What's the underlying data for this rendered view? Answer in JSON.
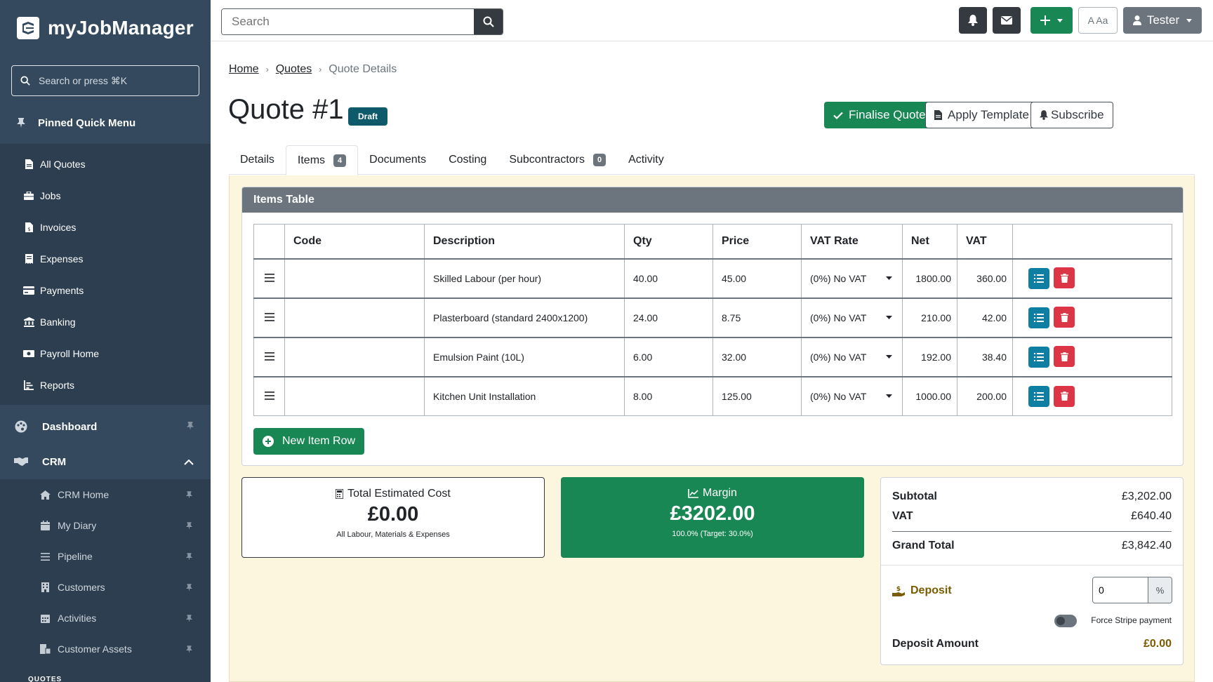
{
  "brand": {
    "name": "myJobManager"
  },
  "sidebar": {
    "search_placeholder": "Search or press ⌘K",
    "pinned_title": "Pinned Quick Menu",
    "pinned_items": [
      {
        "label": "All Quotes",
        "icon": "file-icon"
      },
      {
        "label": "Jobs",
        "icon": "briefcase-icon"
      },
      {
        "label": "Invoices",
        "icon": "file-invoice-icon"
      },
      {
        "label": "Expenses",
        "icon": "receipt-icon"
      },
      {
        "label": "Payments",
        "icon": "credit-card-icon"
      },
      {
        "label": "Banking",
        "icon": "bank-icon"
      },
      {
        "label": "Payroll Home",
        "icon": "money-icon"
      },
      {
        "label": "Reports",
        "icon": "chart-icon"
      }
    ],
    "sections": [
      {
        "label": "Dashboard",
        "icon": "palette-icon"
      },
      {
        "label": "CRM",
        "icon": "handshake-icon"
      }
    ],
    "crm_items": [
      {
        "label": "CRM Home",
        "icon": "home-icon"
      },
      {
        "label": "My Diary",
        "icon": "calendar-icon"
      },
      {
        "label": "Pipeline",
        "icon": "lines-icon"
      },
      {
        "label": "Customers",
        "icon": "building-icon"
      },
      {
        "label": "Activities",
        "icon": "calendar-grid-icon"
      },
      {
        "label": "Customer Assets",
        "icon": "assets-icon"
      }
    ],
    "quotes_section": "QUOTES"
  },
  "topbar": {
    "search_placeholder": "Search",
    "font_toggle": "A Aa",
    "user": "Tester"
  },
  "breadcrumb": {
    "home": "Home",
    "quotes": "Quotes",
    "current": "Quote Details"
  },
  "page": {
    "title": "Quote #1",
    "status": "Draft",
    "finalise": "Finalise Quote",
    "apply_template": "Apply Template",
    "subscribe": "Subscribe"
  },
  "tabs": [
    {
      "label": "Details"
    },
    {
      "label": "Items",
      "count": "4"
    },
    {
      "label": "Documents"
    },
    {
      "label": "Costing"
    },
    {
      "label": "Subcontractors",
      "count": "0"
    },
    {
      "label": "Activity"
    }
  ],
  "items_table": {
    "title": "Items Table",
    "headers": [
      "Code",
      "Description",
      "Qty",
      "Price",
      "VAT Rate",
      "Net",
      "VAT"
    ],
    "rows": [
      {
        "code": "",
        "description": "Skilled Labour (per hour)",
        "qty": "40.00",
        "price": "45.00",
        "vat_rate": "(0%) No VAT",
        "net": "1800.00",
        "vat": "360.00"
      },
      {
        "code": "",
        "description": "Plasterboard (standard 2400x1200)",
        "qty": "24.00",
        "price": "8.75",
        "vat_rate": "(0%) No VAT",
        "net": "210.00",
        "vat": "42.00"
      },
      {
        "code": "",
        "description": "Emulsion Paint (10L)",
        "qty": "6.00",
        "price": "32.00",
        "vat_rate": "(0%) No VAT",
        "net": "192.00",
        "vat": "38.40"
      },
      {
        "code": "",
        "description": "Kitchen Unit Installation",
        "qty": "8.00",
        "price": "125.00",
        "vat_rate": "(0%) No VAT",
        "net": "1000.00",
        "vat": "200.00"
      }
    ],
    "new_row": "New Item Row"
  },
  "cost_card": {
    "title": "Total Estimated Cost",
    "value": "£0.00",
    "sub": "All Labour, Materials & Expenses"
  },
  "margin_card": {
    "title": "Margin",
    "value": "£3202.00",
    "sub": "100.0% (Target: 30.0%)"
  },
  "totals": {
    "subtotal_label": "Subtotal",
    "subtotal": "£3,202.00",
    "vat_label": "VAT",
    "vat": "£640.40",
    "grand_label": "Grand Total",
    "grand": "£3,842.40",
    "deposit_label": "Deposit",
    "deposit_value": "0",
    "deposit_unit": "%",
    "stripe_label": "Force Stripe payment",
    "deposit_amount_label": "Deposit Amount",
    "deposit_amount": "£0.00"
  },
  "colors": {
    "sidebar": "#34495e",
    "accent_green": "#198754",
    "danger": "#dc3545",
    "info": "#0e7ea3"
  }
}
